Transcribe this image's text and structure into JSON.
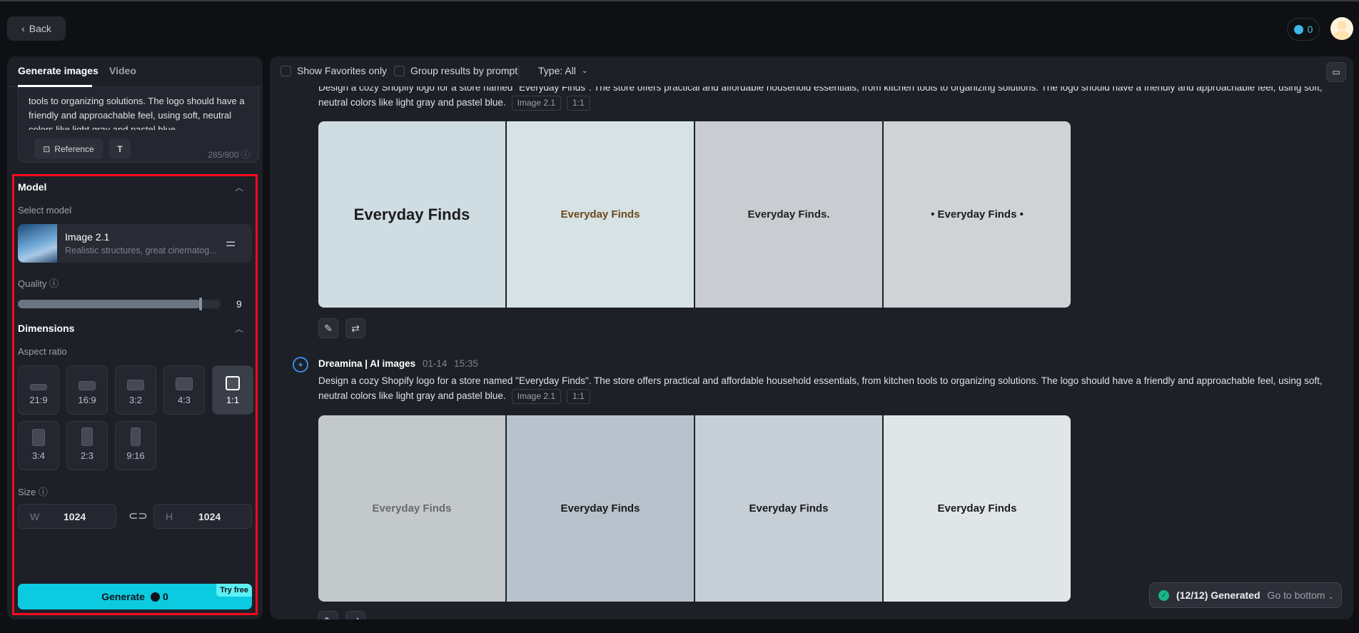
{
  "header": {
    "back_label": "Back",
    "credits": "0"
  },
  "sidebar": {
    "tabs": [
      {
        "label": "Generate images"
      },
      {
        "label": "Video"
      }
    ],
    "prompt_text": "tools to organizing solutions. The logo should have a friendly and approachable feel, using soft, neutral colors like light gray and pastel blue.",
    "reference_label": "Reference",
    "char_count": "285/800",
    "model_section": "Model",
    "select_model_label": "Select model",
    "model_name": "Image 2.1",
    "model_desc": "Realistic structures, great cinematog...",
    "quality_label": "Quality",
    "quality_value": "9",
    "quality_fraction": 0.9,
    "dimensions_section": "Dimensions",
    "aspect_ratio_label": "Aspect ratio",
    "aspect_ratios": [
      {
        "label": "21:9"
      },
      {
        "label": "16:9"
      },
      {
        "label": "3:2"
      },
      {
        "label": "4:3"
      },
      {
        "label": "1:1",
        "selected": true
      },
      {
        "label": "3:4"
      },
      {
        "label": "2:3"
      },
      {
        "label": "9:16"
      }
    ],
    "size_label": "Size",
    "width_prefix": "W",
    "width": "1024",
    "height_prefix": "H",
    "height": "1024",
    "generate_label": "Generate",
    "generate_cost": "0",
    "try_free": "Try free"
  },
  "toolbar": {
    "favorites": "Show Favorites only",
    "group": "Group results by prompt",
    "type": "Type: All"
  },
  "results": [
    {
      "prompt": "Design a cozy Shopify logo for a store named \"Everyday Finds\". The store offers practical and affordable household essentials, from kitchen tools to organizing solutions. The logo should have a friendly and approachable feel, using soft, neutral colors like light gray and pastel blue.",
      "model_tag": "Image 2.1",
      "ratio_tag": "1:1",
      "images": [
        {
          "caption": "Everyday Finds",
          "bg": "#cfdde2",
          "fg": "#1c1c1c"
        },
        {
          "caption": "Everyday Finds",
          "bg": "#d6e2e4",
          "fg": "#6b4a1e"
        },
        {
          "caption": "Everyday Finds.",
          "bg": "#c9ccd0",
          "fg": "#222"
        },
        {
          "caption": "• Everyday Finds •",
          "bg": "#cfd3d6",
          "fg": "#1a1a1a"
        }
      ]
    },
    {
      "author": "Dreamina | AI images",
      "date": "01-14",
      "time": "15:35",
      "prompt": "Design a cozy Shopify logo for a store named \"Everyday Finds\". The store offers practical and affordable household essentials, from kitchen tools to organizing solutions. The logo should have a friendly and approachable feel, using soft, neutral colors like light gray and pastel blue.",
      "model_tag": "Image 2.1",
      "ratio_tag": "1:1",
      "images": [
        {
          "caption": "Everyday Finds",
          "bg": "#c3c8ca",
          "fg": "#6a6a6a"
        },
        {
          "caption": "Everyday Finds",
          "bg": "#b8c2cc",
          "fg": "#1a1a1a"
        },
        {
          "caption": "Everyday Finds",
          "bg": "#c6ced6",
          "fg": "#1a1a1a"
        },
        {
          "caption": "Everyday Finds",
          "bg": "#e0e6e8",
          "fg": "#1a1a1a"
        }
      ]
    }
  ],
  "toast": {
    "status": "(12/12) Generated",
    "action": "Go to bottom"
  },
  "colors": {
    "accent": "#0ccbe0",
    "highlight": "#ff0a1e",
    "success": "#16b58a"
  }
}
